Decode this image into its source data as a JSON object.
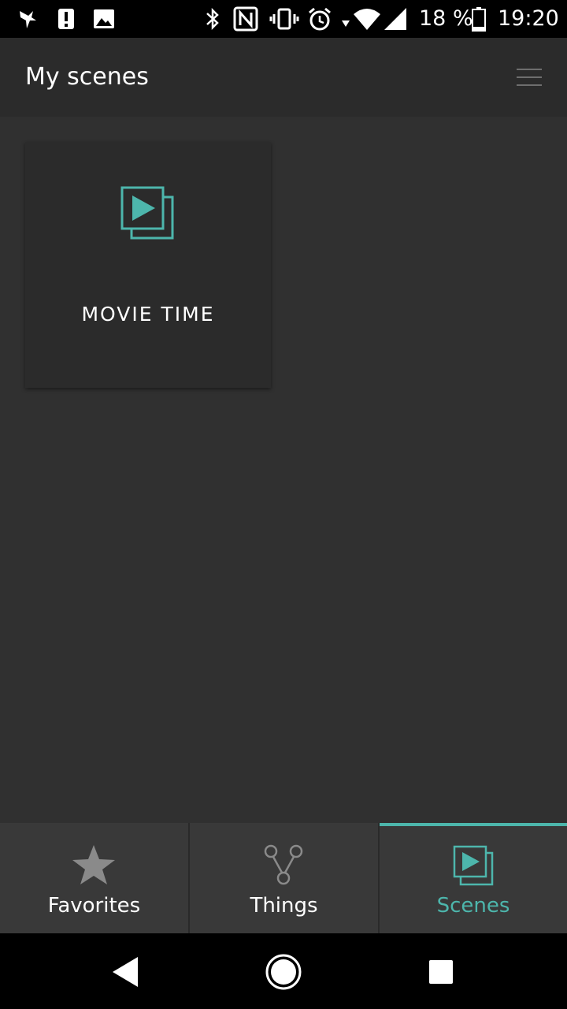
{
  "status_bar": {
    "battery_text": "18 %",
    "time": "19:20",
    "icons": [
      "hummingbird-icon",
      "alert-icon",
      "image-icon",
      "bluetooth-icon",
      "nfc-icon",
      "vibrate-icon",
      "alarm-icon",
      "wifi-icon",
      "signal-icon",
      "battery-icon"
    ]
  },
  "app_bar": {
    "title": "My scenes",
    "menu_icon": "hamburger-menu-icon"
  },
  "scenes": [
    {
      "label": "MOVIE TIME",
      "icon": "scene-play-icon"
    }
  ],
  "tabs": [
    {
      "label": "Favorites",
      "icon": "star-icon",
      "active": false
    },
    {
      "label": "Things",
      "icon": "nodes-icon",
      "active": false
    },
    {
      "label": "Scenes",
      "icon": "scene-play-icon",
      "active": true
    }
  ],
  "nav_bar": {
    "icons": [
      "back-icon",
      "home-icon",
      "recents-icon"
    ]
  },
  "colors": {
    "accent": "#4db6ac",
    "background": "#303030",
    "app_bar": "#2b2b2b",
    "tab_bar": "#393939",
    "inactive_icon": "#8a8a8a",
    "text": "#ffffff"
  }
}
